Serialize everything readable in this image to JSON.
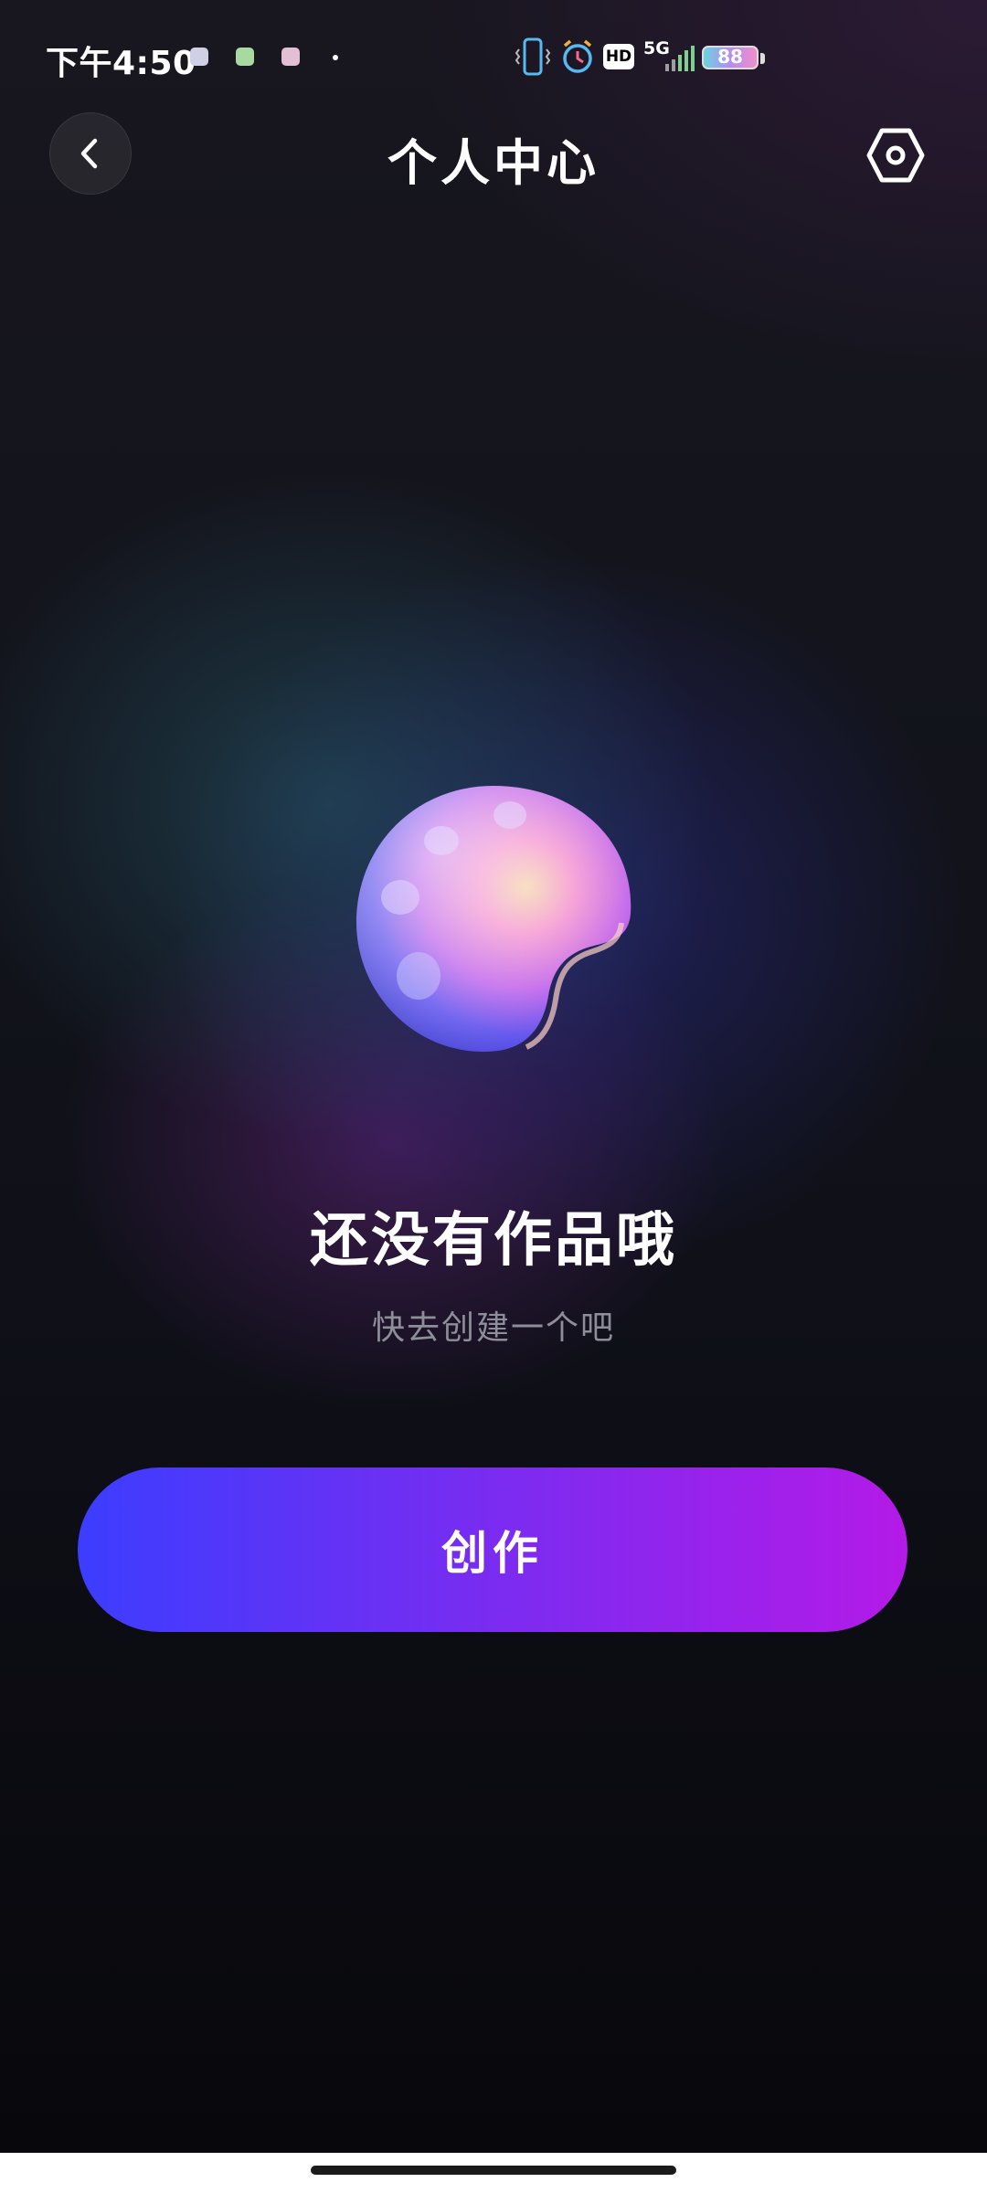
{
  "status_bar": {
    "time": "下午4:50",
    "network": "5G",
    "hd": "HD",
    "battery": "88"
  },
  "header": {
    "title": "个人中心"
  },
  "empty_state": {
    "title": "还没有作品哦",
    "subtitle": "快去创建一个吧"
  },
  "actions": {
    "create_label": "创作"
  },
  "icons": {
    "back": "chevron-left-icon",
    "settings": "gear-hexagon-icon",
    "illustration": "palette-icon"
  },
  "colors": {
    "button_gradient_start": "#3c3dff",
    "button_gradient_end": "#b41ae8",
    "subtitle": "#8d8e99"
  }
}
